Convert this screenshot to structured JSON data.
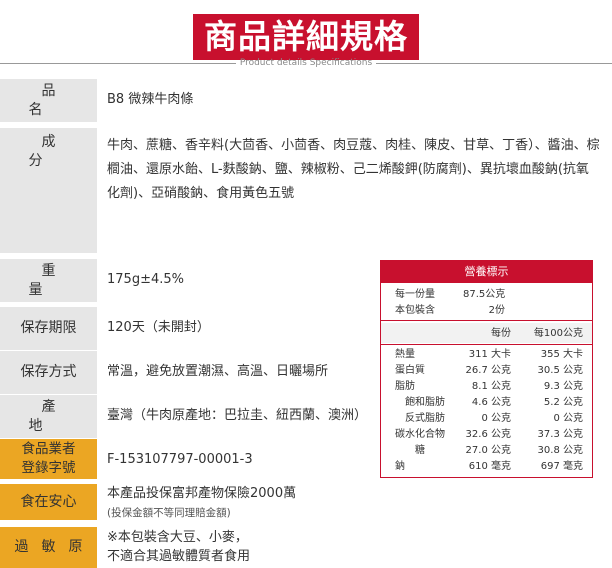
{
  "header": {
    "title": "商品詳細規格",
    "subtitle": "Product details Specifications"
  },
  "specs": [
    {
      "label": "品名",
      "value": "B8 微辣牛肉條"
    },
    {
      "label": "成分",
      "value": "牛肉、蔗糖、香辛料(大茴香、小茴香、肉豆蔻、肉桂、陳皮、甘草、丁香）、醬油、棕櫚油、還原水飴、L-麩酸鈉、鹽、辣椒粉、己二烯酸鉀(防腐劑)、異抗壞血酸鈉(抗氧化劑)、亞硝酸鈉、食用黃色五號"
    },
    {
      "label": "重量",
      "value": "175g±4.5%"
    },
    {
      "label": "保存期限",
      "value": "120天（未開封）"
    },
    {
      "label": "保存方式",
      "value": "常溫，避免放置潮濕、高溫、日曬場所"
    },
    {
      "label": "產地",
      "value": "臺灣（牛肉原產地：巴拉圭、紐西蘭、澳洲）"
    },
    {
      "label_line1": "食品業者",
      "label_line2": "登錄字號",
      "value": "F-153107797-00001-3"
    },
    {
      "label": "食在安心",
      "value": "本產品投保富邦產物保險2000萬",
      "note": "(投保金額不等同理賠金額)"
    },
    {
      "label": "過敏原",
      "value": "※本包裝含大豆、小麥，",
      "value2": "不適合其過敏體質者食用"
    }
  ],
  "nutrition": {
    "title": "營養標示",
    "serving_size_label": "每一份量",
    "serving_size_value": "87.5公克",
    "servings_label": "本包裝含",
    "servings_value": "2份",
    "col_per_serving": "每份",
    "col_per_100g": "每100公克",
    "rows": [
      {
        "name": "熱量",
        "per_serving": "311 大卡",
        "per_100g": "355 大卡"
      },
      {
        "name": "蛋白質",
        "per_serving": "26.7 公克",
        "per_100g": "30.5 公克"
      },
      {
        "name": "脂肪",
        "per_serving": "8.1 公克",
        "per_100g": "9.3 公克"
      },
      {
        "name": "飽和脂肪",
        "per_serving": "4.6 公克",
        "per_100g": "5.2 公克"
      },
      {
        "name": "反式脂肪",
        "per_serving": "0 公克",
        "per_100g": "0 公克"
      },
      {
        "name": "碳水化合物",
        "per_serving": "32.6 公克",
        "per_100g": "37.3 公克"
      },
      {
        "name": "糖",
        "per_serving": "27.0 公克",
        "per_100g": "30.8 公克"
      },
      {
        "name": "鈉",
        "per_serving": "610 毫克",
        "per_100g": "697 毫克"
      }
    ]
  },
  "colors": {
    "accent": "#c8102e",
    "label_gray": "#e6e6e6",
    "label_gold": "#eba623"
  }
}
